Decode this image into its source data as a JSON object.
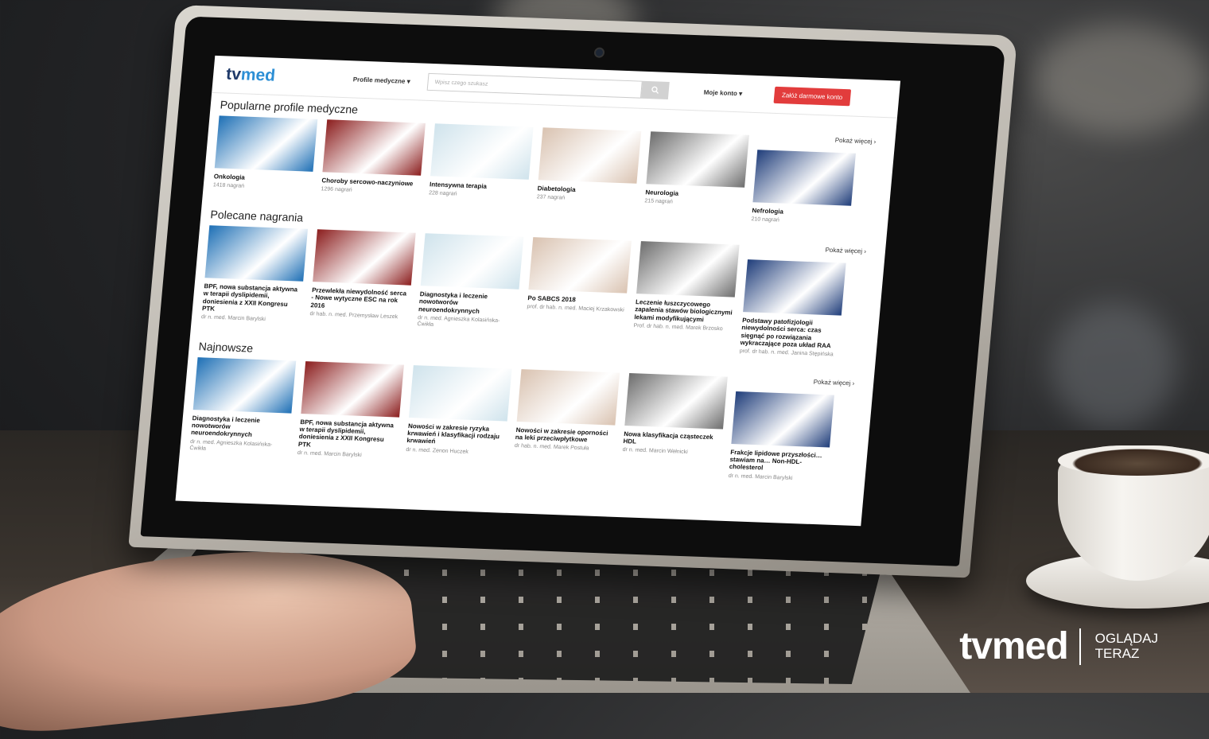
{
  "site": {
    "logo_a": "tv",
    "logo_b": "med",
    "nav_profiles": "Profile medyczne",
    "search_placeholder": "Wpisz czego szukasz",
    "account": "Moje konto",
    "cta": "Załóż darmowe konto"
  },
  "popular": {
    "heading": "Popularne profile medyczne",
    "more": "Pokaż więcej",
    "items": [
      {
        "title": "Onkologia",
        "sub": "1418 nagrań"
      },
      {
        "title": "Choroby sercowo-naczyniowe",
        "sub": "1296 nagrań"
      },
      {
        "title": "Intensywna terapia",
        "sub": "228 nagrań"
      },
      {
        "title": "Diabetologia",
        "sub": "237 nagrań"
      },
      {
        "title": "Neurologia",
        "sub": "215 nagrań"
      },
      {
        "title": "Nefrologia",
        "sub": "210 nagrań"
      }
    ]
  },
  "recommended": {
    "heading": "Polecane nagrania",
    "more": "Pokaż więcej",
    "items": [
      {
        "title": "BPF, nowa substancja aktywna w terapii dyslipidemii, doniesienia z XXII Kongresu PTK",
        "sub": "dr n. med. Marcin Barylski"
      },
      {
        "title": "Przewlekła niewydolność serca - Nowe wytyczne ESC na rok 2016",
        "sub": "dr hab. n. med. Przemysław Leszek"
      },
      {
        "title": "Diagnostyka i leczenie nowotworów neuroendokrynnych",
        "sub": "dr n. med. Agnieszka Kolasińska-Ćwikła"
      },
      {
        "title": "Po SABCS 2018",
        "sub": "prof. dr hab. n. med. Maciej Krzakowski"
      },
      {
        "title": "Leczenie łuszczycowego zapalenia stawów biologicznymi lekami modyfikującymi",
        "sub": "Prof. dr hab. n. med. Marek Brzosko"
      },
      {
        "title": "Podstawy patofizjologii niewydolności serca: czas sięgnąć po rozwiązania wykraczające poza układ RAA",
        "sub": "prof. dr hab. n. med. Janina Stępińska"
      }
    ]
  },
  "newest": {
    "heading": "Najnowsze",
    "more": "Pokaż więcej",
    "items": [
      {
        "title": "Diagnostyka i leczenie nowotworów neuroendokrynnych",
        "sub": "dr n. med. Agnieszka Kolasińska-Ćwikła"
      },
      {
        "title": "BPF, nowa substancja aktywna w terapii dyslipidemii, doniesienia z XXII Kongresu PTK",
        "sub": "dr n. med. Marcin Barylski"
      },
      {
        "title": "Nowości w zakresie ryzyka krwawień i klasyfikacji rodzaju krwawień",
        "sub": "dr n. med. Zenon Huczek"
      },
      {
        "title": "Nowości w zakresie oporności na leki przeciwpłytkowe",
        "sub": "dr hab. n. med. Marek Postuła"
      },
      {
        "title": "Nowa klasyfikacja cząsteczek HDL",
        "sub": "dr n. med. Marcin Wełnicki"
      },
      {
        "title": "Frakcje lipidowe przyszłości… stawiam na… Non-HDL-cholesterol",
        "sub": "dr n. med. Marcin Barylski"
      }
    ]
  },
  "thumb_colors": [
    "#1d6fb5",
    "#8b1d1d",
    "#cfe3ec",
    "#d9c2b0",
    "#6d6d6d",
    "#1f3d7a"
  ],
  "brand": {
    "big": "tvmed",
    "line1": "OGLĄDAJ",
    "line2": "TERAZ"
  }
}
